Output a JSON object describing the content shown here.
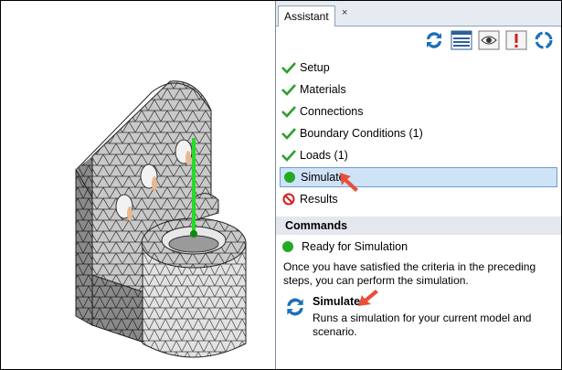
{
  "panel": {
    "tab_label": "Assistant",
    "tab_close": "×"
  },
  "toolbar": {
    "icons": [
      "refresh-icon",
      "list-view-icon",
      "eye-icon",
      "alert-icon",
      "cycle-icon"
    ]
  },
  "steps": [
    {
      "label": "Setup",
      "status": "complete"
    },
    {
      "label": "Materials",
      "status": "complete"
    },
    {
      "label": "Connections",
      "status": "complete"
    },
    {
      "label": "Boundary Conditions (1)",
      "status": "complete"
    },
    {
      "label": "Loads (1)",
      "status": "complete"
    },
    {
      "label": "Simulate",
      "status": "ready"
    },
    {
      "label": "Results",
      "status": "unavailable"
    }
  ],
  "commands": {
    "header": "Commands",
    "status": "Ready for Simulation",
    "description": "Once you have satisfied the criteria in the preceding steps, you can perform the simulation.",
    "simulate_label": "Simulate",
    "simulate_desc": "Runs a simulation for your current model and scenario."
  },
  "colors": {
    "check": "#2e9e2e",
    "ready": "#22aa22",
    "results": "#d42020",
    "selection": "#cfe3f7",
    "arrow": "#e8503a"
  }
}
